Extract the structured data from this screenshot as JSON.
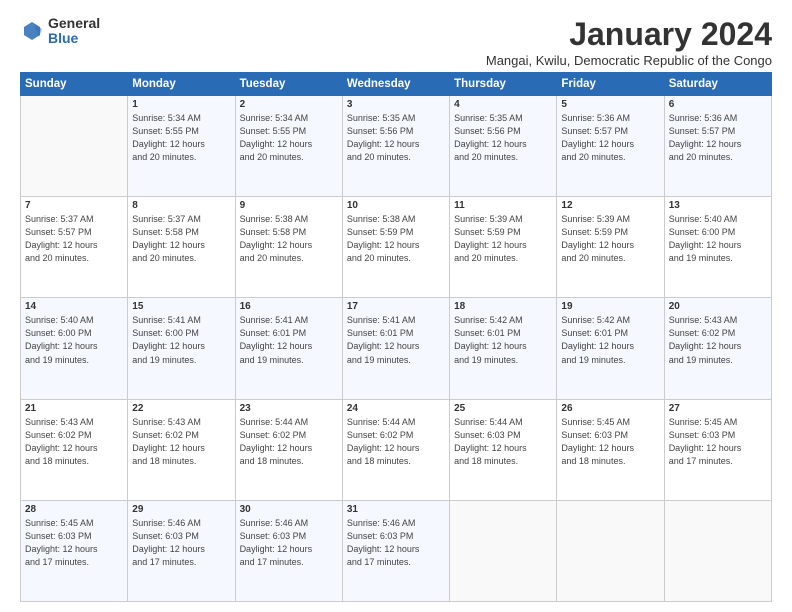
{
  "logo": {
    "general": "General",
    "blue": "Blue"
  },
  "title": "January 2024",
  "location": "Mangai, Kwilu, Democratic Republic of the Congo",
  "weekdays": [
    "Sunday",
    "Monday",
    "Tuesday",
    "Wednesday",
    "Thursday",
    "Friday",
    "Saturday"
  ],
  "weeks": [
    [
      {
        "num": "",
        "info": ""
      },
      {
        "num": "1",
        "info": "Sunrise: 5:34 AM\nSunset: 5:55 PM\nDaylight: 12 hours\nand 20 minutes."
      },
      {
        "num": "2",
        "info": "Sunrise: 5:34 AM\nSunset: 5:55 PM\nDaylight: 12 hours\nand 20 minutes."
      },
      {
        "num": "3",
        "info": "Sunrise: 5:35 AM\nSunset: 5:56 PM\nDaylight: 12 hours\nand 20 minutes."
      },
      {
        "num": "4",
        "info": "Sunrise: 5:35 AM\nSunset: 5:56 PM\nDaylight: 12 hours\nand 20 minutes."
      },
      {
        "num": "5",
        "info": "Sunrise: 5:36 AM\nSunset: 5:57 PM\nDaylight: 12 hours\nand 20 minutes."
      },
      {
        "num": "6",
        "info": "Sunrise: 5:36 AM\nSunset: 5:57 PM\nDaylight: 12 hours\nand 20 minutes."
      }
    ],
    [
      {
        "num": "7",
        "info": "Sunrise: 5:37 AM\nSunset: 5:57 PM\nDaylight: 12 hours\nand 20 minutes."
      },
      {
        "num": "8",
        "info": "Sunrise: 5:37 AM\nSunset: 5:58 PM\nDaylight: 12 hours\nand 20 minutes."
      },
      {
        "num": "9",
        "info": "Sunrise: 5:38 AM\nSunset: 5:58 PM\nDaylight: 12 hours\nand 20 minutes."
      },
      {
        "num": "10",
        "info": "Sunrise: 5:38 AM\nSunset: 5:59 PM\nDaylight: 12 hours\nand 20 minutes."
      },
      {
        "num": "11",
        "info": "Sunrise: 5:39 AM\nSunset: 5:59 PM\nDaylight: 12 hours\nand 20 minutes."
      },
      {
        "num": "12",
        "info": "Sunrise: 5:39 AM\nSunset: 5:59 PM\nDaylight: 12 hours\nand 20 minutes."
      },
      {
        "num": "13",
        "info": "Sunrise: 5:40 AM\nSunset: 6:00 PM\nDaylight: 12 hours\nand 19 minutes."
      }
    ],
    [
      {
        "num": "14",
        "info": "Sunrise: 5:40 AM\nSunset: 6:00 PM\nDaylight: 12 hours\nand 19 minutes."
      },
      {
        "num": "15",
        "info": "Sunrise: 5:41 AM\nSunset: 6:00 PM\nDaylight: 12 hours\nand 19 minutes."
      },
      {
        "num": "16",
        "info": "Sunrise: 5:41 AM\nSunset: 6:01 PM\nDaylight: 12 hours\nand 19 minutes."
      },
      {
        "num": "17",
        "info": "Sunrise: 5:41 AM\nSunset: 6:01 PM\nDaylight: 12 hours\nand 19 minutes."
      },
      {
        "num": "18",
        "info": "Sunrise: 5:42 AM\nSunset: 6:01 PM\nDaylight: 12 hours\nand 19 minutes."
      },
      {
        "num": "19",
        "info": "Sunrise: 5:42 AM\nSunset: 6:01 PM\nDaylight: 12 hours\nand 19 minutes."
      },
      {
        "num": "20",
        "info": "Sunrise: 5:43 AM\nSunset: 6:02 PM\nDaylight: 12 hours\nand 19 minutes."
      }
    ],
    [
      {
        "num": "21",
        "info": "Sunrise: 5:43 AM\nSunset: 6:02 PM\nDaylight: 12 hours\nand 18 minutes."
      },
      {
        "num": "22",
        "info": "Sunrise: 5:43 AM\nSunset: 6:02 PM\nDaylight: 12 hours\nand 18 minutes."
      },
      {
        "num": "23",
        "info": "Sunrise: 5:44 AM\nSunset: 6:02 PM\nDaylight: 12 hours\nand 18 minutes."
      },
      {
        "num": "24",
        "info": "Sunrise: 5:44 AM\nSunset: 6:02 PM\nDaylight: 12 hours\nand 18 minutes."
      },
      {
        "num": "25",
        "info": "Sunrise: 5:44 AM\nSunset: 6:03 PM\nDaylight: 12 hours\nand 18 minutes."
      },
      {
        "num": "26",
        "info": "Sunrise: 5:45 AM\nSunset: 6:03 PM\nDaylight: 12 hours\nand 18 minutes."
      },
      {
        "num": "27",
        "info": "Sunrise: 5:45 AM\nSunset: 6:03 PM\nDaylight: 12 hours\nand 17 minutes."
      }
    ],
    [
      {
        "num": "28",
        "info": "Sunrise: 5:45 AM\nSunset: 6:03 PM\nDaylight: 12 hours\nand 17 minutes."
      },
      {
        "num": "29",
        "info": "Sunrise: 5:46 AM\nSunset: 6:03 PM\nDaylight: 12 hours\nand 17 minutes."
      },
      {
        "num": "30",
        "info": "Sunrise: 5:46 AM\nSunset: 6:03 PM\nDaylight: 12 hours\nand 17 minutes."
      },
      {
        "num": "31",
        "info": "Sunrise: 5:46 AM\nSunset: 6:03 PM\nDaylight: 12 hours\nand 17 minutes."
      },
      {
        "num": "",
        "info": ""
      },
      {
        "num": "",
        "info": ""
      },
      {
        "num": "",
        "info": ""
      }
    ]
  ]
}
